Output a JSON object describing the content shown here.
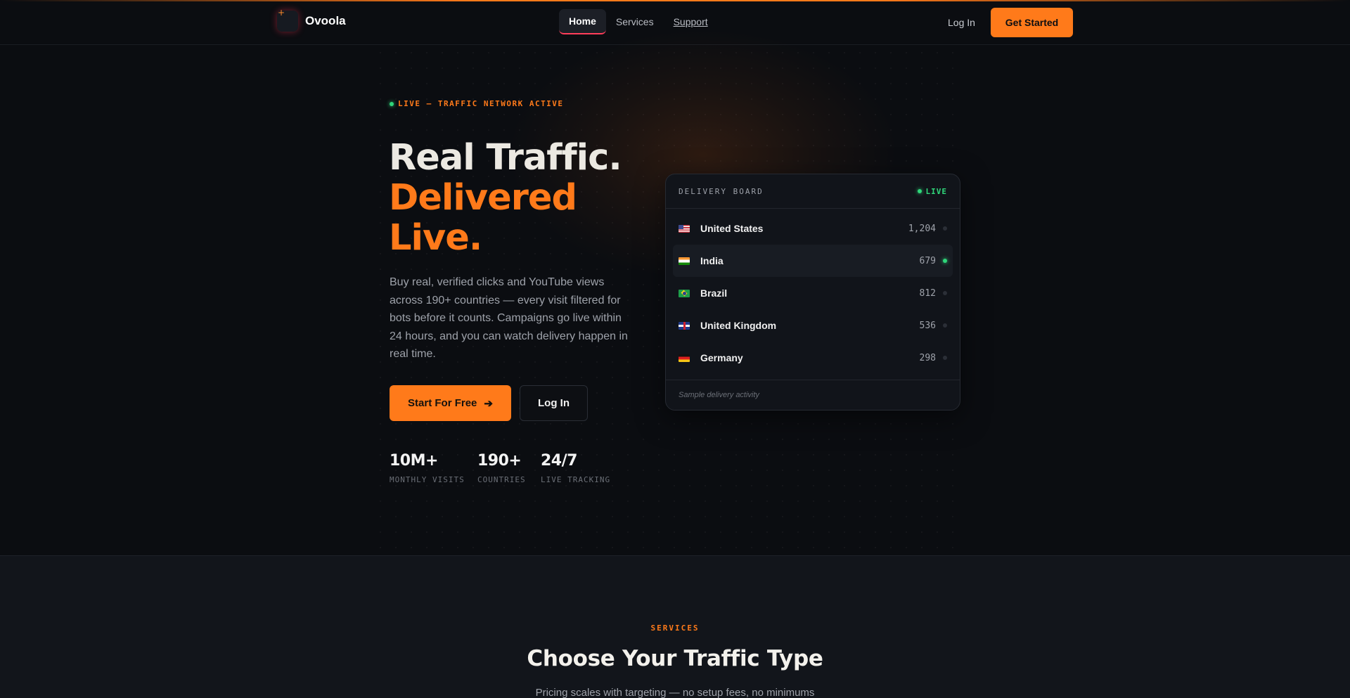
{
  "brand": {
    "name": "Ovoola"
  },
  "nav": {
    "links": [
      {
        "label": "Home"
      },
      {
        "label": "Services"
      },
      {
        "label": "Support"
      }
    ],
    "login": "Log In",
    "cta": "Get Started"
  },
  "hero": {
    "tag": "LIVE — TRAFFIC NETWORK ACTIVE",
    "title_line1": "Real Traffic.",
    "title_line2": "Delivered",
    "title_line3": "Live.",
    "lead": "Buy real, verified clicks and YouTube views across 190+ countries — every visit filtered for bots before it counts. Campaigns go live within 24 hours, and you can watch delivery happen in real time.",
    "primary_btn": "Start For Free",
    "secondary_btn": "Log In",
    "stats": [
      {
        "value": "10M+",
        "label": "MONTHLY VISITS"
      },
      {
        "value": "190+",
        "label": "COUNTRIES"
      },
      {
        "value": "24/7",
        "label": "LIVE TRACKING"
      }
    ]
  },
  "board": {
    "title": "DELIVERY BOARD",
    "live": "LIVE",
    "rows": [
      {
        "country": "United States",
        "count": "1,204",
        "flag": "us-flag-icon"
      },
      {
        "country": "India",
        "count": "679",
        "flag": "india-flag-icon"
      },
      {
        "country": "Brazil",
        "count": "812",
        "flag": "brazil-flag-icon"
      },
      {
        "country": "United Kingdom",
        "count": "536",
        "flag": "uk-flag-icon"
      },
      {
        "country": "Germany",
        "count": "298",
        "flag": "germany-flag-icon"
      }
    ],
    "footer": "Sample delivery activity"
  },
  "services": {
    "tag": "SERVICES",
    "title": "Choose Your Traffic Type",
    "subtitle": "Pricing scales with targeting — no setup fees, no minimums"
  },
  "colors": {
    "accent": "#ff7a1a",
    "live_green": "#2fd67a",
    "background": "#0b0d11"
  }
}
